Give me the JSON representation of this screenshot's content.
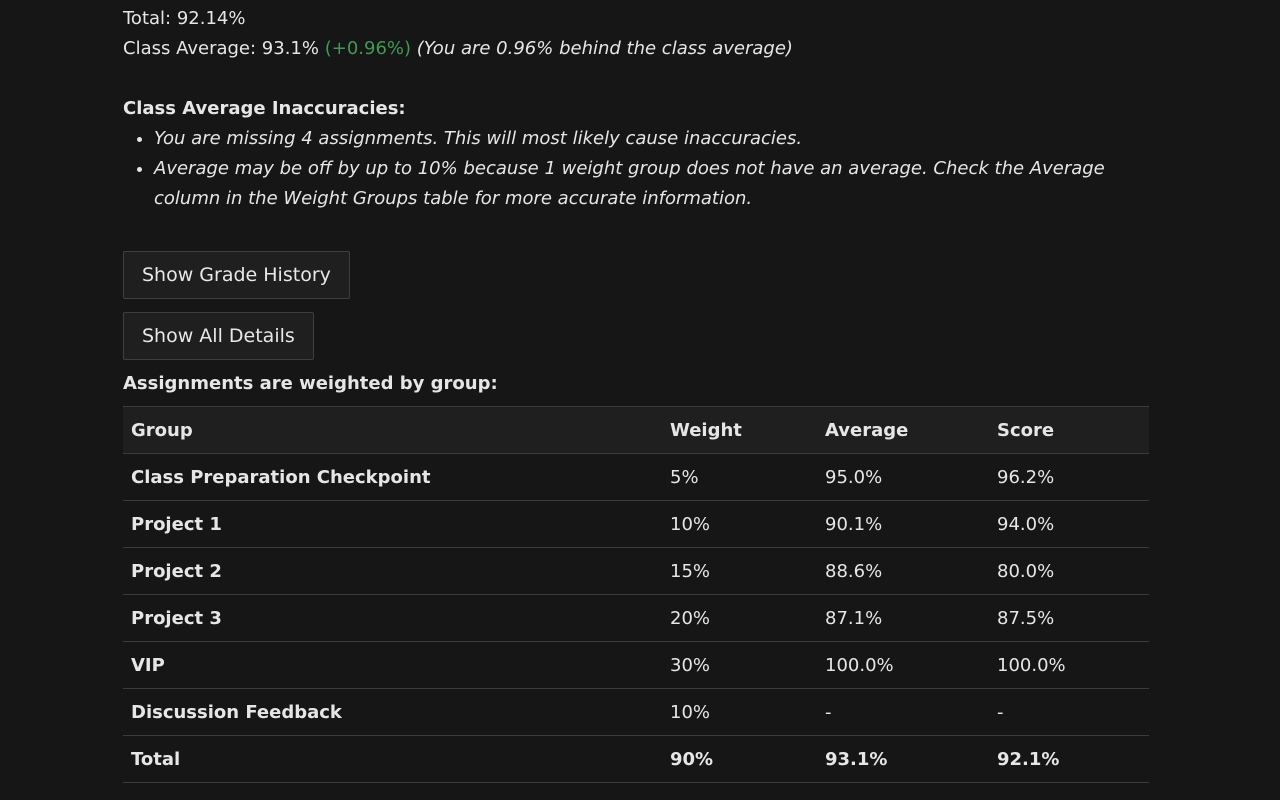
{
  "summary": {
    "total_label": "Total:",
    "total_value": "92.14%",
    "class_average_label": "Class Average:",
    "class_average_value": "93.1%",
    "difference": "(+0.96%)",
    "behind_note": "(You are 0.96% behind the class average)",
    "difference_color": "#3f9a55"
  },
  "inaccuracies": {
    "title": "Class Average Inaccuracies:",
    "items": [
      "You are missing 4 assignments. This will most likely cause inaccuracies.",
      "Average may be off by up to 10% because 1 weight group does not have an average. Check the Average column in the Weight Groups table for more accurate information."
    ]
  },
  "buttons": {
    "grade_history": "Show Grade History",
    "all_details": "Show All Details"
  },
  "weights": {
    "title": "Assignments are weighted by group:",
    "headers": {
      "group": "Group",
      "weight": "Weight",
      "average": "Average",
      "score": "Score"
    },
    "rows": [
      {
        "group": "Class Preparation Checkpoint",
        "weight": "5%",
        "average": "95.0%",
        "score": "96.2%"
      },
      {
        "group": "Project 1",
        "weight": "10%",
        "average": "90.1%",
        "score": "94.0%"
      },
      {
        "group": "Project 2",
        "weight": "15%",
        "average": "88.6%",
        "score": "80.0%"
      },
      {
        "group": "Project 3",
        "weight": "20%",
        "average": "87.1%",
        "score": "87.5%"
      },
      {
        "group": "VIP",
        "weight": "30%",
        "average": "100.0%",
        "score": "100.0%"
      },
      {
        "group": "Discussion Feedback",
        "weight": "10%",
        "average": "-",
        "score": "-"
      }
    ],
    "total": {
      "group": "Total",
      "weight": "90%",
      "average": "93.1%",
      "score": "92.1%"
    }
  }
}
